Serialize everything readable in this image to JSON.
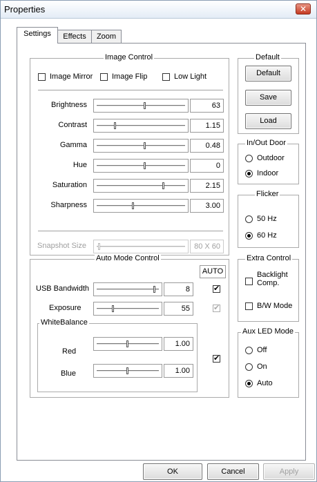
{
  "window": {
    "title": "Properties",
    "close_icon": "close-icon (x)"
  },
  "tabs": [
    {
      "label": "Settings",
      "active": true
    },
    {
      "label": "Effects",
      "active": false
    },
    {
      "label": "Zoom",
      "active": false
    }
  ],
  "image_control": {
    "title": "Image Control",
    "checkboxes": [
      {
        "label": "Image Mirror",
        "checked": false
      },
      {
        "label": "Image Flip",
        "checked": false
      },
      {
        "label": "Low Light",
        "checked": false
      }
    ],
    "sliders": [
      {
        "label": "Brightness",
        "value": "63",
        "position": 0.55
      },
      {
        "label": "Contrast",
        "value": "1.15",
        "position": 0.2
      },
      {
        "label": "Gamma",
        "value": "0.48",
        "position": 0.55
      },
      {
        "label": "Hue",
        "value": "0",
        "position": 0.55
      },
      {
        "label": "Saturation",
        "value": "2.15",
        "position": 0.77
      },
      {
        "label": "Sharpness",
        "value": "3.00",
        "position": 0.41
      }
    ],
    "snapshot": {
      "label": "Snapshot Size",
      "value": "80 X 60",
      "position": 0.02,
      "enabled": false
    }
  },
  "default_group": {
    "title": "Default",
    "buttons": [
      "Default",
      "Save",
      "Load"
    ]
  },
  "in_out_door": {
    "title": "In/Out Door",
    "options": [
      {
        "label": "Outdoor",
        "selected": false
      },
      {
        "label": "Indoor",
        "selected": true
      }
    ]
  },
  "flicker": {
    "title": "Flicker",
    "options": [
      {
        "label": "50 Hz",
        "selected": false
      },
      {
        "label": "60 Hz",
        "selected": true
      }
    ]
  },
  "auto_mode": {
    "title": "Auto Mode Control",
    "auto_header": "AUTO",
    "rows": [
      {
        "label": "USB Bandwidth",
        "value": "8",
        "position": 0.95,
        "auto": true,
        "auto_enabled": true
      },
      {
        "label": "Exposure",
        "value": "55",
        "position": 0.25,
        "auto": true,
        "auto_enabled": false
      }
    ],
    "white_balance": {
      "title": "WhiteBalance",
      "rows": [
        {
          "label": "Red",
          "value": "1.00",
          "position": 0.5
        },
        {
          "label": "Blue",
          "value": "1.00",
          "position": 0.5
        }
      ],
      "auto": true
    }
  },
  "extra_control": {
    "title": "Extra Control",
    "options": [
      {
        "label_line1": "Backlight",
        "label_line2": "Comp.",
        "checked": false
      },
      {
        "label": "B/W Mode",
        "checked": false
      }
    ]
  },
  "aux_led": {
    "title": "Aux LED Mode",
    "options": [
      {
        "label": "Off",
        "selected": false
      },
      {
        "label": "On",
        "selected": false
      },
      {
        "label": "Auto",
        "selected": true
      }
    ]
  },
  "footer": {
    "ok": "OK",
    "cancel": "Cancel",
    "apply": "Apply"
  }
}
